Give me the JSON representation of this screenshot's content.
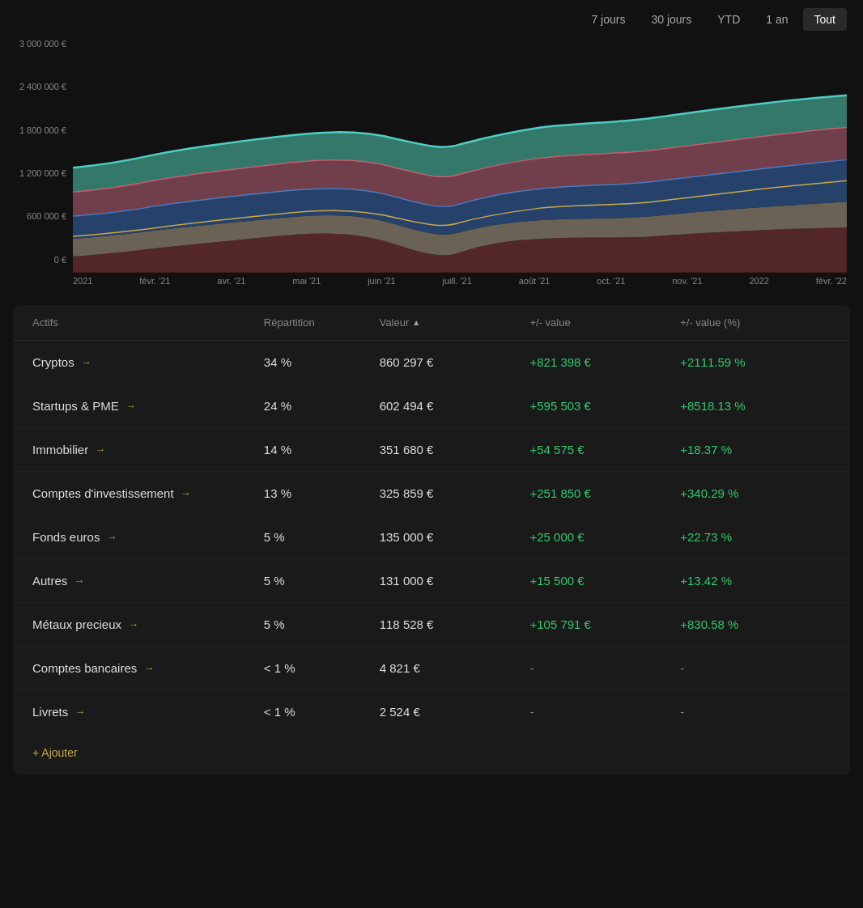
{
  "timeRange": {
    "buttons": [
      {
        "label": "7 jours",
        "id": "7j",
        "active": false
      },
      {
        "label": "30 jours",
        "id": "30j",
        "active": false
      },
      {
        "label": "YTD",
        "id": "ytd",
        "active": false
      },
      {
        "label": "1 an",
        "id": "1an",
        "active": false
      },
      {
        "label": "Tout",
        "id": "tout",
        "active": true
      }
    ]
  },
  "chart": {
    "yLabels": [
      "3 000 000 €",
      "2 400 000 €",
      "1 800 000 €",
      "1 200 000 €",
      "600 000 €",
      "0 €"
    ],
    "xLabels": [
      "2021",
      "févr. '21",
      "avr. '21",
      "mai '21",
      "juin '21",
      "juill. '21",
      "août '21",
      "oct. '21",
      "nov. '21",
      "2022",
      "févr. '22"
    ]
  },
  "table": {
    "headers": {
      "actifs": "Actifs",
      "repartition": "Répartition",
      "valeur": "Valeur",
      "plusValue": "+/- value",
      "plusValuePct": "+/- value (%)"
    },
    "rows": [
      {
        "name": "Cryptos",
        "repartition": "34 %",
        "valeur": "860 297 €",
        "plusValue": "+821 398 €",
        "plusValuePct": "+2111.59 %",
        "neutral": false
      },
      {
        "name": "Startups & PME",
        "repartition": "24 %",
        "valeur": "602 494 €",
        "plusValue": "+595 503 €",
        "plusValuePct": "+8518.13 %",
        "neutral": false
      },
      {
        "name": "Immobilier",
        "repartition": "14 %",
        "valeur": "351 680 €",
        "plusValue": "+54 575 €",
        "plusValuePct": "+18.37 %",
        "neutral": false
      },
      {
        "name": "Comptes d'investissement",
        "repartition": "13 %",
        "valeur": "325 859 €",
        "plusValue": "+251 850 €",
        "plusValuePct": "+340.29 %",
        "neutral": false
      },
      {
        "name": "Fonds euros",
        "repartition": "5 %",
        "valeur": "135 000 €",
        "plusValue": "+25 000 €",
        "plusValuePct": "+22.73 %",
        "neutral": false
      },
      {
        "name": "Autres",
        "repartition": "5 %",
        "valeur": "131 000 €",
        "plusValue": "+15 500 €",
        "plusValuePct": "+13.42 %",
        "neutral": false
      },
      {
        "name": "Métaux precieux",
        "repartition": "5 %",
        "valeur": "118 528 €",
        "plusValue": "+105 791 €",
        "plusValuePct": "+830.58 %",
        "neutral": false
      },
      {
        "name": "Comptes bancaires",
        "repartition": "< 1 %",
        "valeur": "4 821 €",
        "plusValue": "-",
        "plusValuePct": "-",
        "neutral": true
      },
      {
        "name": "Livrets",
        "repartition": "< 1 %",
        "valeur": "2 524 €",
        "plusValue": "-",
        "plusValuePct": "-",
        "neutral": true
      }
    ],
    "addButton": "+ Ajouter"
  }
}
